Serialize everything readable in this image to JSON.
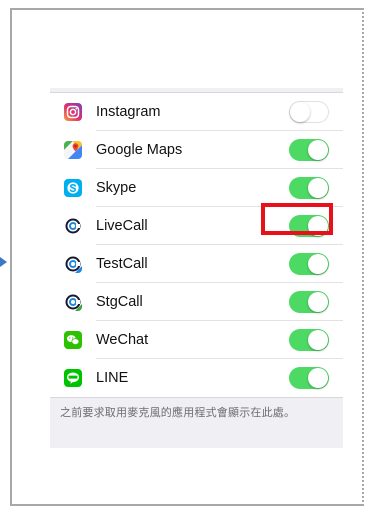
{
  "settings": {
    "apps": [
      {
        "name": "Instagram",
        "icon": "instagram-icon",
        "enabled": false
      },
      {
        "name": "Google Maps",
        "icon": "google-maps-icon",
        "enabled": true
      },
      {
        "name": "Skype",
        "icon": "skype-icon",
        "enabled": true
      },
      {
        "name": "LiveCall",
        "icon": "livecall-icon",
        "enabled": true,
        "highlighted": true
      },
      {
        "name": "TestCall",
        "icon": "testcall-icon",
        "enabled": true
      },
      {
        "name": "StgCall",
        "icon": "stgcall-icon",
        "enabled": true
      },
      {
        "name": "WeChat",
        "icon": "wechat-icon",
        "enabled": true
      },
      {
        "name": "LINE",
        "icon": "line-icon",
        "enabled": true
      }
    ],
    "footer_note": "之前要求取用麥克風的應用程式會顯示在此處。"
  },
  "colors": {
    "toggle_on": "#4cd964",
    "highlight_box": "#e8111b",
    "group_background": "#efeff4"
  }
}
